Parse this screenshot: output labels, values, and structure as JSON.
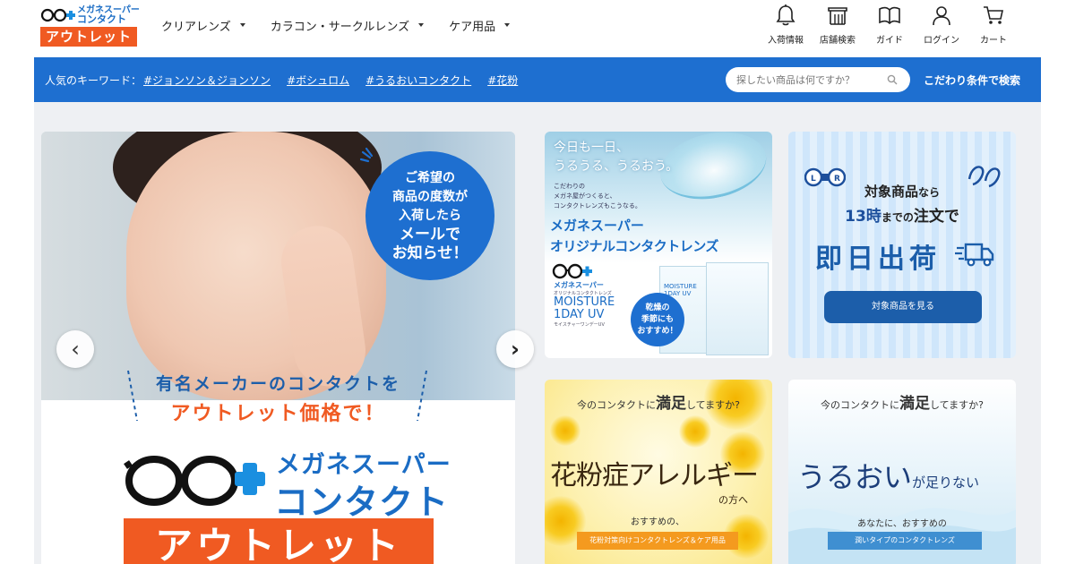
{
  "header": {
    "logo": {
      "small_line1": "メガネスーパー",
      "small_line2": "コンタクト",
      "badge": "アウトレット"
    },
    "nav": [
      {
        "label": "クリアレンズ"
      },
      {
        "label": "カラコン・サークルレンズ"
      },
      {
        "label": "ケア用品"
      }
    ],
    "icons": [
      {
        "icon": "bell-icon",
        "label": "入荷情報"
      },
      {
        "icon": "store-icon",
        "label": "店舗検索"
      },
      {
        "icon": "book-icon",
        "label": "ガイド"
      },
      {
        "icon": "user-icon",
        "label": "ログイン"
      },
      {
        "icon": "cart-icon",
        "label": "カート"
      }
    ]
  },
  "keyword_bar": {
    "label": "人気のキーワード：",
    "keywords": [
      "#ジョンソン＆ジョンソン",
      "#ボシュロム",
      "#うるおいコンタクト",
      "#花粉"
    ],
    "search_placeholder": "探したい商品は何ですか？",
    "advanced_search": "こだわり条件で検索"
  },
  "hero": {
    "circle_line1": "ご希望の",
    "circle_line2": "商品の度数が",
    "circle_line3": "入荷したら",
    "circle_line4": "メールで",
    "circle_line5": "お知らせ！",
    "tagline1": "有名メーカーのコンタクトを",
    "tagline2": "アウトレット価格で！",
    "logo_line1": "メガネスーパー",
    "logo_line2": "コンタクト",
    "logo_badge": "アウトレット",
    "prev": "‹",
    "next": "›"
  },
  "banners": {
    "original": {
      "tag1": "今日も一日、",
      "tag2": "うるうる、うるおう。",
      "small1": "こだわりの",
      "small2": "メガネ屋がつくると、",
      "small3": "コンタクトレンズもこうなる。",
      "heading1": "メガネスーパー",
      "heading2": "オリジナルコンタクトレンズ",
      "brand_name": "メガネスーパー",
      "brand_sub": "オリジナルコンタクトレンズ",
      "product1": "MOISTURE",
      "product2": "1DAY UV",
      "product_sub": "モイスチャーワンデーUV",
      "bubble1": "乾燥の",
      "bubble2": "季節にも",
      "bubble3": "おすすめ！",
      "box_text1": "MOISTURE",
      "box_text2": "1DAY UV"
    },
    "sameday": {
      "line1a": "対象商品",
      "line1b": "なら",
      "line2a": "13時",
      "line2b": "までの",
      "line2c": "注文で",
      "line3": "即日出荷",
      "button": "対象商品を見る"
    },
    "hayfever": {
      "q_pre": "今のコンタクトに",
      "q_big": "満足",
      "q_post": "してますか?",
      "main": "花粉症アレルギー",
      "sub": "の方へ",
      "recommend": "おすすめの、",
      "badge": "花粉対策向けコンタクトレンズ＆ケア用品"
    },
    "moisture": {
      "q_pre": "今のコンタクトに",
      "q_big": "満足",
      "q_post": "してますか?",
      "main_a": "うるおい",
      "main_b": "が足りない",
      "recommend": "あなたに、おすすめの",
      "badge": "潤いタイプのコンタクトレンズ"
    }
  },
  "colors": {
    "brand_blue": "#1e6fd0",
    "brand_orange": "#f05a22",
    "navy": "#1c5eaa",
    "main_bg": "#eef0f3"
  }
}
